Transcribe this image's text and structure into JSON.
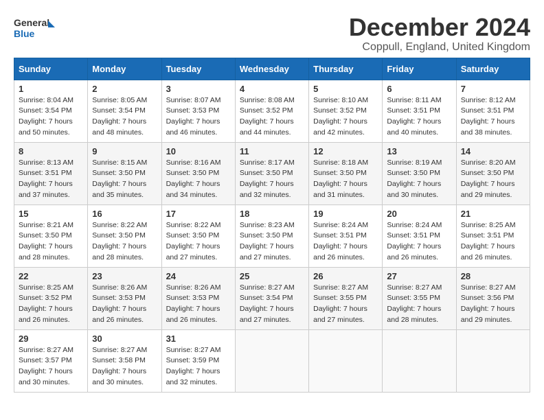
{
  "logo": {
    "line1": "General",
    "line2": "Blue"
  },
  "title": {
    "month": "December 2024",
    "location": "Coppull, England, United Kingdom"
  },
  "headers": [
    "Sunday",
    "Monday",
    "Tuesday",
    "Wednesday",
    "Thursday",
    "Friday",
    "Saturday"
  ],
  "weeks": [
    [
      {
        "day": "1",
        "sunrise": "8:04 AM",
        "sunset": "3:54 PM",
        "daylight": "7 hours and 50 minutes."
      },
      {
        "day": "2",
        "sunrise": "8:05 AM",
        "sunset": "3:54 PM",
        "daylight": "7 hours and 48 minutes."
      },
      {
        "day": "3",
        "sunrise": "8:07 AM",
        "sunset": "3:53 PM",
        "daylight": "7 hours and 46 minutes."
      },
      {
        "day": "4",
        "sunrise": "8:08 AM",
        "sunset": "3:52 PM",
        "daylight": "7 hours and 44 minutes."
      },
      {
        "day": "5",
        "sunrise": "8:10 AM",
        "sunset": "3:52 PM",
        "daylight": "7 hours and 42 minutes."
      },
      {
        "day": "6",
        "sunrise": "8:11 AM",
        "sunset": "3:51 PM",
        "daylight": "7 hours and 40 minutes."
      },
      {
        "day": "7",
        "sunrise": "8:12 AM",
        "sunset": "3:51 PM",
        "daylight": "7 hours and 38 minutes."
      }
    ],
    [
      {
        "day": "8",
        "sunrise": "8:13 AM",
        "sunset": "3:51 PM",
        "daylight": "7 hours and 37 minutes."
      },
      {
        "day": "9",
        "sunrise": "8:15 AM",
        "sunset": "3:50 PM",
        "daylight": "7 hours and 35 minutes."
      },
      {
        "day": "10",
        "sunrise": "8:16 AM",
        "sunset": "3:50 PM",
        "daylight": "7 hours and 34 minutes."
      },
      {
        "day": "11",
        "sunrise": "8:17 AM",
        "sunset": "3:50 PM",
        "daylight": "7 hours and 32 minutes."
      },
      {
        "day": "12",
        "sunrise": "8:18 AM",
        "sunset": "3:50 PM",
        "daylight": "7 hours and 31 minutes."
      },
      {
        "day": "13",
        "sunrise": "8:19 AM",
        "sunset": "3:50 PM",
        "daylight": "7 hours and 30 minutes."
      },
      {
        "day": "14",
        "sunrise": "8:20 AM",
        "sunset": "3:50 PM",
        "daylight": "7 hours and 29 minutes."
      }
    ],
    [
      {
        "day": "15",
        "sunrise": "8:21 AM",
        "sunset": "3:50 PM",
        "daylight": "7 hours and 28 minutes."
      },
      {
        "day": "16",
        "sunrise": "8:22 AM",
        "sunset": "3:50 PM",
        "daylight": "7 hours and 28 minutes."
      },
      {
        "day": "17",
        "sunrise": "8:22 AM",
        "sunset": "3:50 PM",
        "daylight": "7 hours and 27 minutes."
      },
      {
        "day": "18",
        "sunrise": "8:23 AM",
        "sunset": "3:50 PM",
        "daylight": "7 hours and 27 minutes."
      },
      {
        "day": "19",
        "sunrise": "8:24 AM",
        "sunset": "3:51 PM",
        "daylight": "7 hours and 26 minutes."
      },
      {
        "day": "20",
        "sunrise": "8:24 AM",
        "sunset": "3:51 PM",
        "daylight": "7 hours and 26 minutes."
      },
      {
        "day": "21",
        "sunrise": "8:25 AM",
        "sunset": "3:51 PM",
        "daylight": "7 hours and 26 minutes."
      }
    ],
    [
      {
        "day": "22",
        "sunrise": "8:25 AM",
        "sunset": "3:52 PM",
        "daylight": "7 hours and 26 minutes."
      },
      {
        "day": "23",
        "sunrise": "8:26 AM",
        "sunset": "3:53 PM",
        "daylight": "7 hours and 26 minutes."
      },
      {
        "day": "24",
        "sunrise": "8:26 AM",
        "sunset": "3:53 PM",
        "daylight": "7 hours and 26 minutes."
      },
      {
        "day": "25",
        "sunrise": "8:27 AM",
        "sunset": "3:54 PM",
        "daylight": "7 hours and 27 minutes."
      },
      {
        "day": "26",
        "sunrise": "8:27 AM",
        "sunset": "3:55 PM",
        "daylight": "7 hours and 27 minutes."
      },
      {
        "day": "27",
        "sunrise": "8:27 AM",
        "sunset": "3:55 PM",
        "daylight": "7 hours and 28 minutes."
      },
      {
        "day": "28",
        "sunrise": "8:27 AM",
        "sunset": "3:56 PM",
        "daylight": "7 hours and 29 minutes."
      }
    ],
    [
      {
        "day": "29",
        "sunrise": "8:27 AM",
        "sunset": "3:57 PM",
        "daylight": "7 hours and 30 minutes."
      },
      {
        "day": "30",
        "sunrise": "8:27 AM",
        "sunset": "3:58 PM",
        "daylight": "7 hours and 30 minutes."
      },
      {
        "day": "31",
        "sunrise": "8:27 AM",
        "sunset": "3:59 PM",
        "daylight": "7 hours and 32 minutes."
      },
      null,
      null,
      null,
      null
    ]
  ],
  "labels": {
    "sunrise": "Sunrise:",
    "sunset": "Sunset:",
    "daylight": "Daylight:"
  }
}
